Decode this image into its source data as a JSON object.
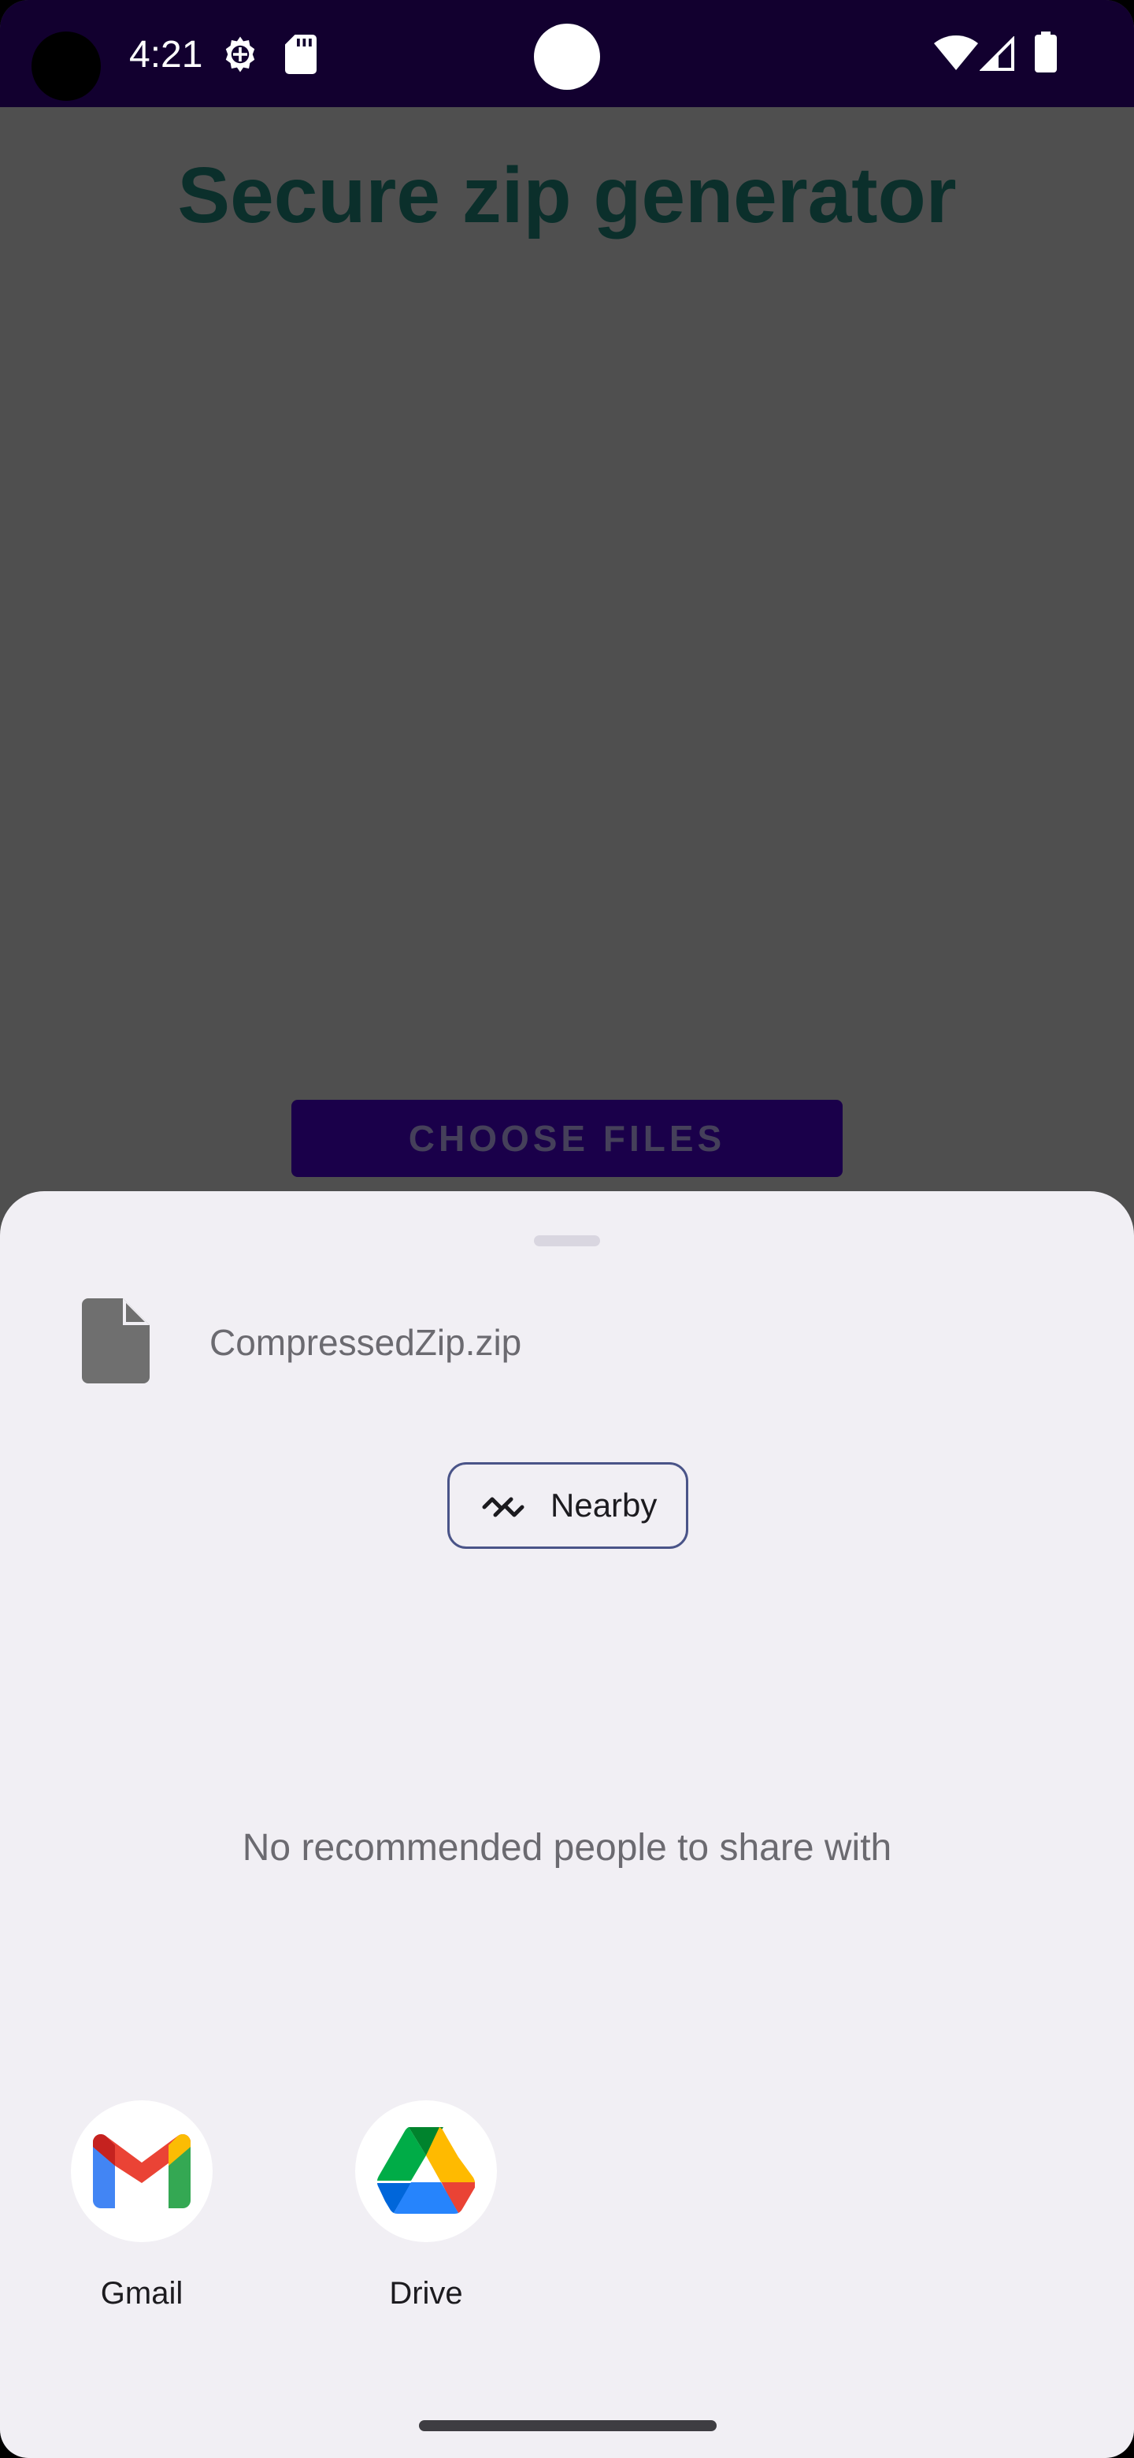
{
  "status_bar": {
    "time": "4:21",
    "icons": [
      "settings-icon",
      "sd-card-icon",
      "wifi-icon",
      "signal-icon",
      "battery-icon"
    ]
  },
  "app": {
    "title": "Secure zip generator",
    "choose_files_label": "CHOOSE FILES"
  },
  "share_sheet": {
    "file_name": "CompressedZip.zip",
    "file_icon": "file-icon",
    "nearby_label": "Nearby",
    "no_recommendations": "No recommended people to share with",
    "apps": [
      {
        "label": "Gmail",
        "icon": "gmail-icon"
      },
      {
        "label": "Drive",
        "icon": "drive-icon"
      }
    ]
  },
  "colors": {
    "status_bar": "#12002f",
    "scrim": "#4f4f4f",
    "sheet_background": "#f1eff4",
    "button": "#1a004a",
    "title": "#0b2f2b",
    "chip_border": "#4a5488"
  }
}
